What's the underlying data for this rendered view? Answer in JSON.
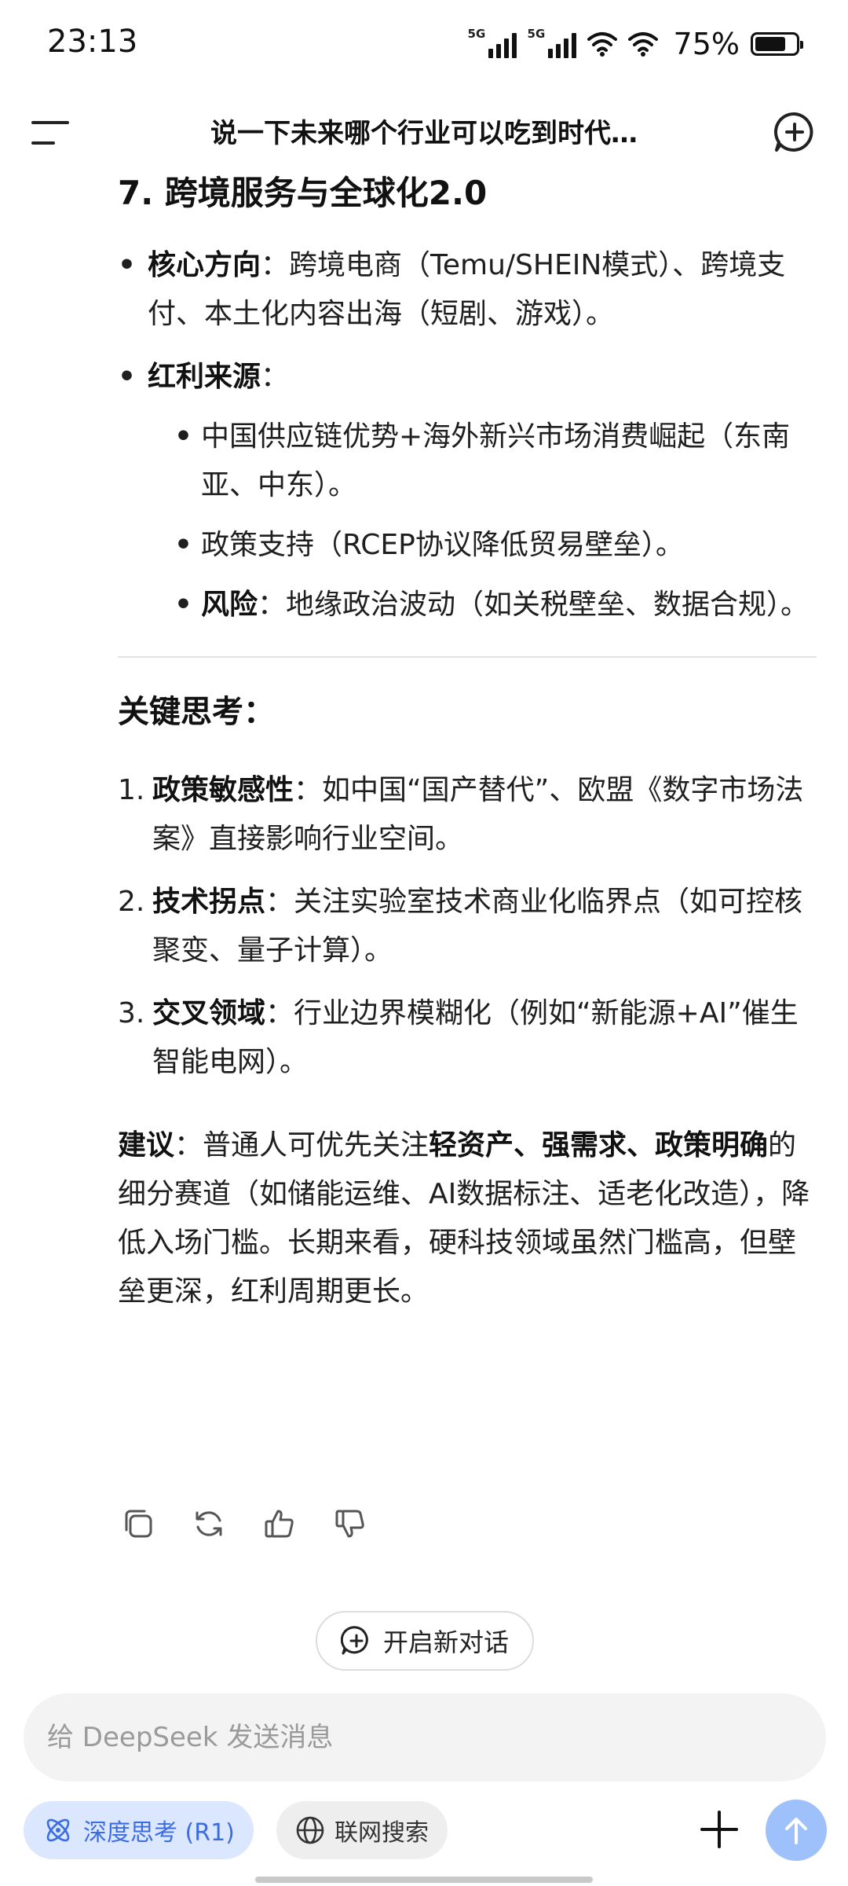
{
  "status_bar": {
    "time": "23:13",
    "network_1": "5G",
    "network_2": "5G",
    "battery": "75%",
    "battery_level": 0.75
  },
  "header": {
    "title": "说一下未来哪个行业可以吃到时代…",
    "menu_icon": "menu-icon",
    "new_chat_icon": "new-chat-icon"
  },
  "content": {
    "section_heading": "7. 跨境服务与全球化2.0",
    "bullets": [
      {
        "label": "核心方向",
        "text": "：跨境电商（Temu/SHEIN模式）、跨境支付、本土化内容出海（短剧、游戏）。"
      },
      {
        "label": "红利来源",
        "text": "："
      }
    ],
    "sub_bullets": [
      {
        "label": "",
        "text": "中国供应链优势+海外新兴市场消费崛起（东南亚、中东）。"
      },
      {
        "label": "",
        "text": "政策支持（RCEP协议降低贸易壁垒）。"
      },
      {
        "label": "风险",
        "text": "：地缘政治波动（如关税壁垒、数据合规）。"
      }
    ],
    "thinking_heading": "关键思考：",
    "points": [
      {
        "num": "1.",
        "label": "政策敏感性",
        "text": "：如中国“国产替代”、欧盟《数字市场法案》直接影响行业空间。"
      },
      {
        "num": "2.",
        "label": "技术拐点",
        "text": "：关注实验室技术商业化临界点（如可控核聚变、量子计算）。"
      },
      {
        "num": "3.",
        "label": "交叉领域",
        "text": "：行业边界模糊化（例如“新能源+AI”催生智能电网）。"
      }
    ],
    "advice": {
      "label": "建议",
      "text1": "：普通人可优先关注",
      "emphasis": "轻资产、强需求、政策明确",
      "text2": "的细分赛道（如储能运维、AI数据标注、适老化改造），降低入场门槛。长期来看，硬科技领域虽然门槛高，但壁垒更深，红利周期更长。"
    }
  },
  "actions": {
    "icons": [
      "copy-icon",
      "regenerate-icon",
      "thumbs-up-icon",
      "thumbs-down-icon"
    ]
  },
  "new_chat_button": "开启新对话",
  "input": {
    "placeholder": "给 DeepSeek 发送消息",
    "value": ""
  },
  "toolbar": {
    "deep_think_label": "深度思考 (R1)",
    "web_search_label": "联网搜索"
  },
  "colors": {
    "accent": "#3b6de0",
    "deep_chip_bg": "#dbe6ff",
    "send_button": "#9ec1fb"
  }
}
